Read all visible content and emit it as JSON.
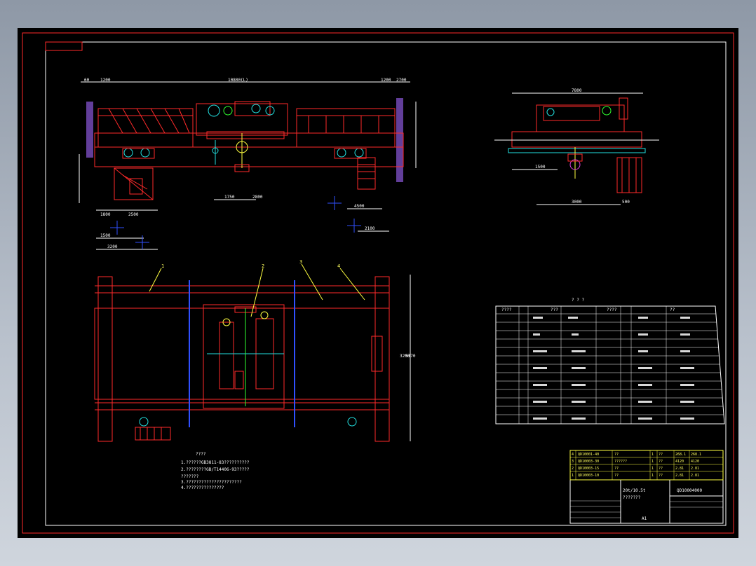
{
  "drawing": {
    "top_view_span": "10800(L)",
    "top_view_left_dims": [
      "60",
      "1200"
    ],
    "top_view_right_dims": [
      "1200",
      "2700"
    ],
    "lower_dims": [
      "1800",
      "2500",
      "1500",
      "3200",
      "1750",
      "2800",
      "4500",
      "2100"
    ],
    "side_view_width": "7800",
    "side_view_bottom_dims": [
      "3000",
      "500",
      "1500"
    ],
    "plan_part_labels": [
      "1",
      "2",
      "3",
      "4"
    ],
    "plan_width_dims": [
      "3200",
      "5370"
    ]
  },
  "notes": {
    "title": "????",
    "lines": [
      "1.??????GB3811-83??????????",
      "2.????????GB/T14406-93?????",
      "   ???????",
      "3.??????????????????????",
      "4.???????????????"
    ]
  },
  "spec_table": {
    "title": "? ? ?",
    "header": [
      "????",
      "???",
      "????",
      "??"
    ]
  },
  "title_block": {
    "drawing_number": "QD10004000",
    "name_line1": "20t/10.5t",
    "name_line2": "???????",
    "sheet_size": "A1",
    "bom_rows": [
      [
        "4",
        "QD10001-40",
        "??",
        "1",
        "??",
        "268.1",
        "268.1"
      ],
      [
        "3",
        "QD10003-30",
        "??????",
        "1",
        "??",
        "4120",
        "4120"
      ],
      [
        "2",
        "QD10003-15",
        "??",
        "1",
        "??",
        "2.81",
        "2.81"
      ],
      [
        "1",
        "QD10003-10",
        "??",
        "1",
        "??",
        "2.81",
        "2.81"
      ]
    ]
  }
}
